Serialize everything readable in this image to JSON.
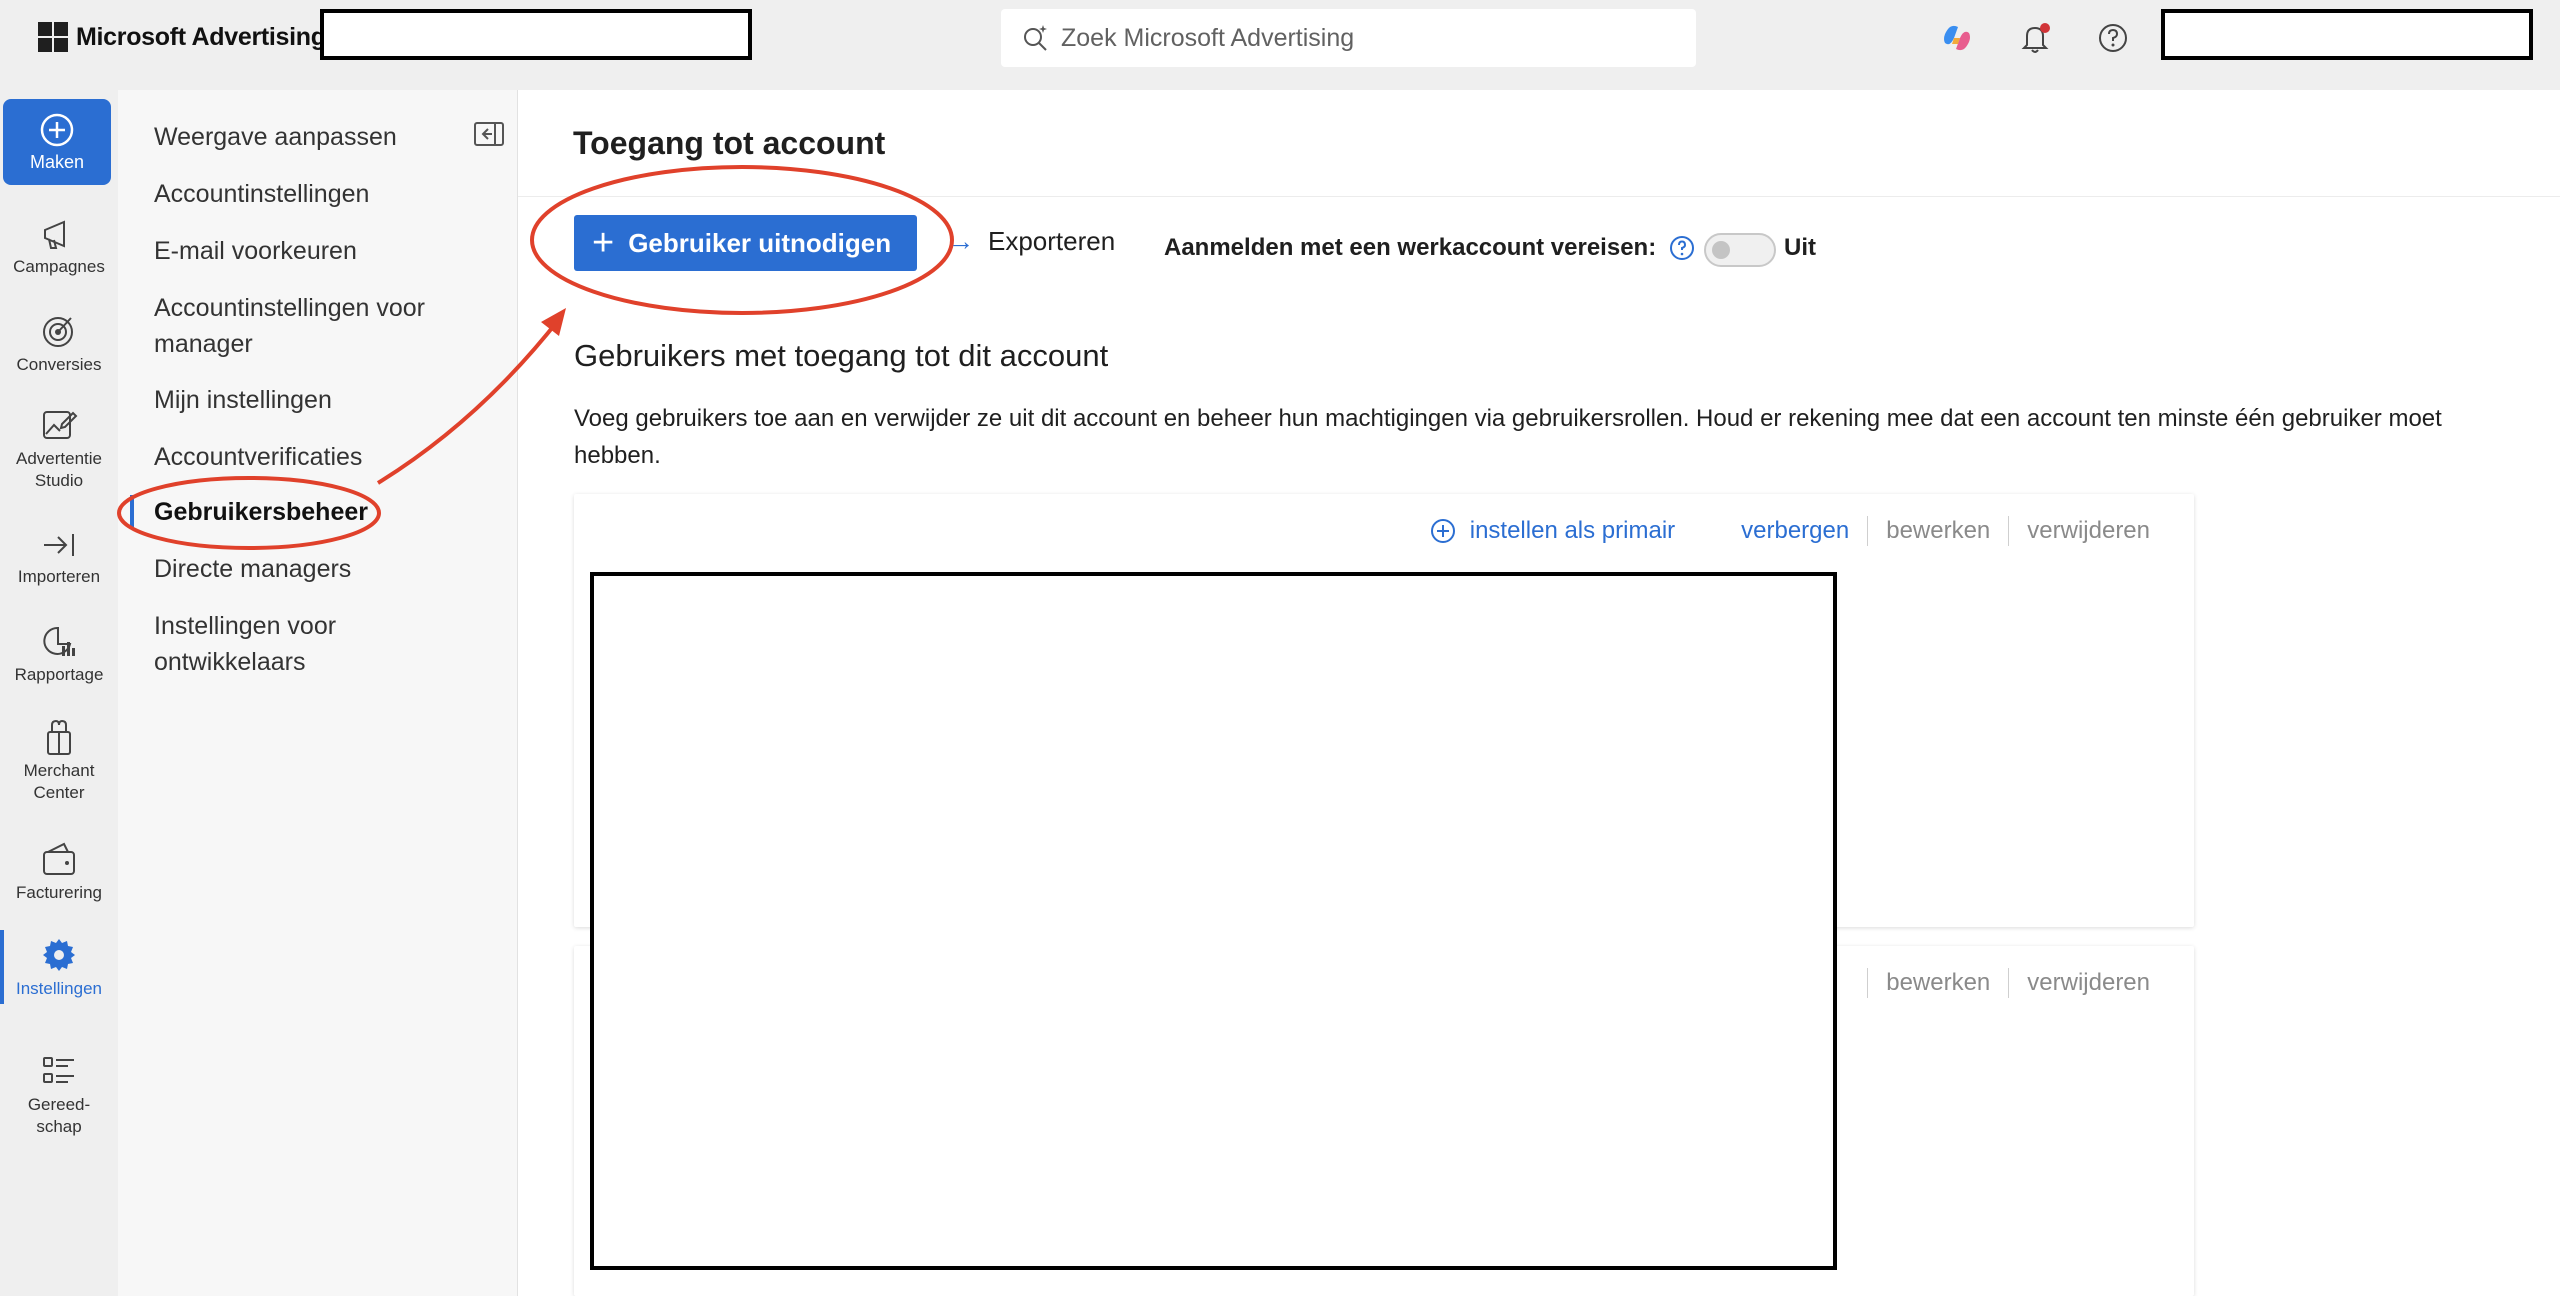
{
  "brand": {
    "name": "Microsoft Advertising"
  },
  "search": {
    "placeholder": "Zoek Microsoft Advertising"
  },
  "rail": {
    "create_label": "Maken",
    "items": [
      {
        "label": "Campagnes",
        "icon": "megaphone-icon"
      },
      {
        "label": "Conversies",
        "icon": "target-icon"
      },
      {
        "label": "Advertentie Studio",
        "icon": "image-edit-icon"
      },
      {
        "label": "Importeren",
        "icon": "import-icon"
      },
      {
        "label": "Rapportage",
        "icon": "report-icon"
      },
      {
        "label": "Merchant Center",
        "icon": "gift-bag-icon"
      },
      {
        "label": "Facturering",
        "icon": "wallet-icon"
      },
      {
        "label": "Instellingen",
        "icon": "gear-icon",
        "active": true
      },
      {
        "label": "Gereed-schap",
        "icon": "tools-list-icon"
      }
    ]
  },
  "subnav": {
    "items": [
      {
        "label": "Weergave aanpassen"
      },
      {
        "label": "Accountinstellingen"
      },
      {
        "label": "E-mail voorkeuren"
      },
      {
        "label": "Accountinstellingen voor manager"
      },
      {
        "label": "Mijn instellingen"
      },
      {
        "label": "Accountverificaties"
      },
      {
        "label": "Gebruikersbeheer",
        "active": true
      },
      {
        "label": "Directe managers"
      },
      {
        "label": "Instellingen voor ontwikkelaars"
      }
    ]
  },
  "main": {
    "title": "Toegang tot account",
    "invite_label": "Gebruiker uitnodigen",
    "export_label": "Exporteren",
    "signin_label": "Aanmelden met een werkaccount vereisen:",
    "toggle_state": "Uit",
    "section_title": "Gebruikers met toegang tot dit account",
    "section_desc": "Voeg gebruikers toe aan en verwijder ze uit dit account en beheer hun machtigingen via gebruikersrollen. Houd er rekening mee dat een account ten minste één gebruiker moet hebben.",
    "card1_actions": {
      "set_primary": "instellen als primair",
      "hide": "verbergen",
      "edit": "bewerken",
      "remove": "verwijderen"
    },
    "card2_actions": {
      "edit": "bewerken",
      "remove": "verwijderen"
    }
  },
  "colors": {
    "accent": "#2b6ed2",
    "annotation": "#e0412b"
  }
}
